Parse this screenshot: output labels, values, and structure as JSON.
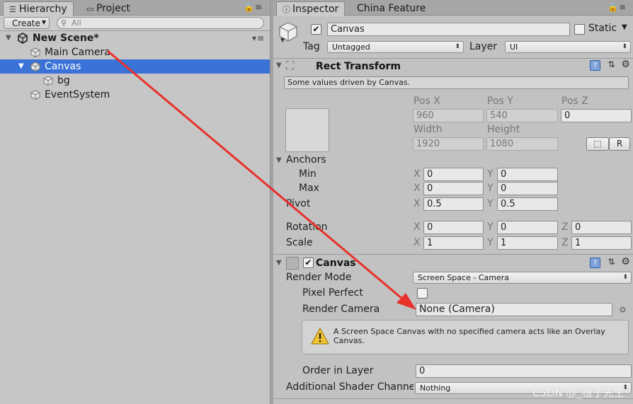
{
  "hierarchy": {
    "tab_label": "Hierarchy",
    "tab2_label": "Project",
    "create_label": "Create",
    "search_placeholder": "All",
    "scene_name": "New Scene*",
    "items": [
      {
        "label": "Main Camera"
      },
      {
        "label": "Canvas"
      },
      {
        "label": "bg"
      },
      {
        "label": "EventSystem"
      }
    ]
  },
  "inspector": {
    "tab_label": "Inspector",
    "tab2_label": "China Feature",
    "object_name": "Canvas",
    "static_label": "Static",
    "tag_label": "Tag",
    "tag_value": "Untagged",
    "layer_label": "Layer",
    "layer_value": "UI"
  },
  "rect_transform": {
    "title": "Rect Transform",
    "note": "Some values driven by Canvas.",
    "pos_x_label": "Pos X",
    "pos_y_label": "Pos Y",
    "pos_z_label": "Pos Z",
    "pos_x": "960",
    "pos_y": "540",
    "pos_z": "0",
    "width_label": "Width",
    "height_label": "Height",
    "width": "1920",
    "height": "1080",
    "r_label": "R",
    "anchors_label": "Anchors",
    "min_label": "Min",
    "max_label": "Max",
    "pivot_label": "Pivot",
    "rotation_label": "Rotation",
    "scale_label": "Scale",
    "x": "X",
    "y": "Y",
    "z": "Z",
    "min_x": "0",
    "min_y": "0",
    "max_x": "0",
    "max_y": "0",
    "pivot_x": "0.5",
    "pivot_y": "0.5",
    "rot_x": "0",
    "rot_y": "0",
    "rot_z": "0",
    "scale_x": "1",
    "scale_y": "1",
    "scale_z": "1"
  },
  "canvas": {
    "title": "Canvas",
    "render_mode_label": "Render Mode",
    "render_mode_value": "Screen Space - Camera",
    "pixel_perfect_label": "Pixel Perfect",
    "render_camera_label": "Render Camera",
    "render_camera_value": "None (Camera)",
    "help_text": "A Screen Space Canvas with no specified camera acts like an Overlay Canvas.",
    "order_label": "Order in Layer",
    "order_value": "0",
    "shader_label": "Additional Shader Channe",
    "shader_value": "Nothing"
  },
  "watermark": "CSDN @_橙子先生",
  "colors": {
    "selection": "#3a72d8",
    "arrow": "#e8312a"
  }
}
